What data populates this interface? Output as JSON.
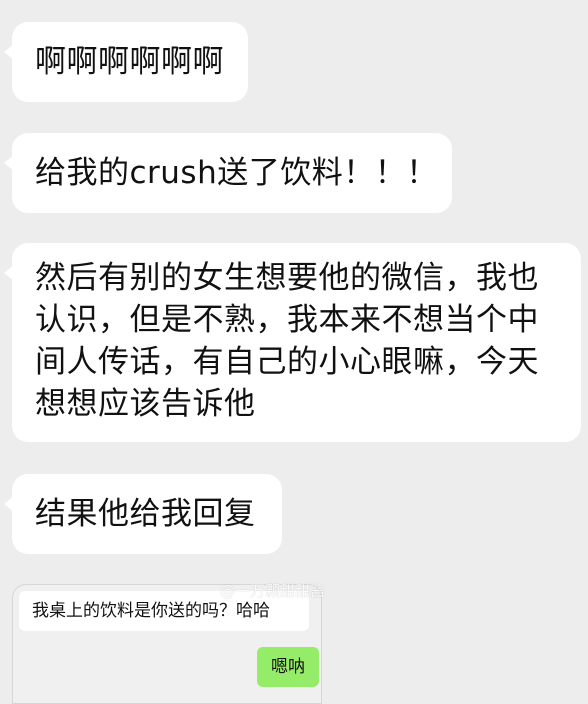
{
  "messages": [
    {
      "text": "啊啊啊啊啊啊"
    },
    {
      "text": "给我的crush送了饮料！！！"
    },
    {
      "text": "然后有别的女生想要他的微信，我也认识，但是不熟，我本来不想当个中间人传话，有自己的小心眼嘛，今天想想应该告诉他"
    },
    {
      "text": "结果他给我回复"
    }
  ],
  "screenshot": {
    "incoming_text": "我桌上的饮料是你送的吗？哈哈",
    "outgoing_text": "嗯呐"
  },
  "watermark": "@一万颗甜甜酱",
  "colors": {
    "background": "#ededed",
    "bubble_incoming": "#ffffff",
    "bubble_outgoing": "#95ec69"
  }
}
